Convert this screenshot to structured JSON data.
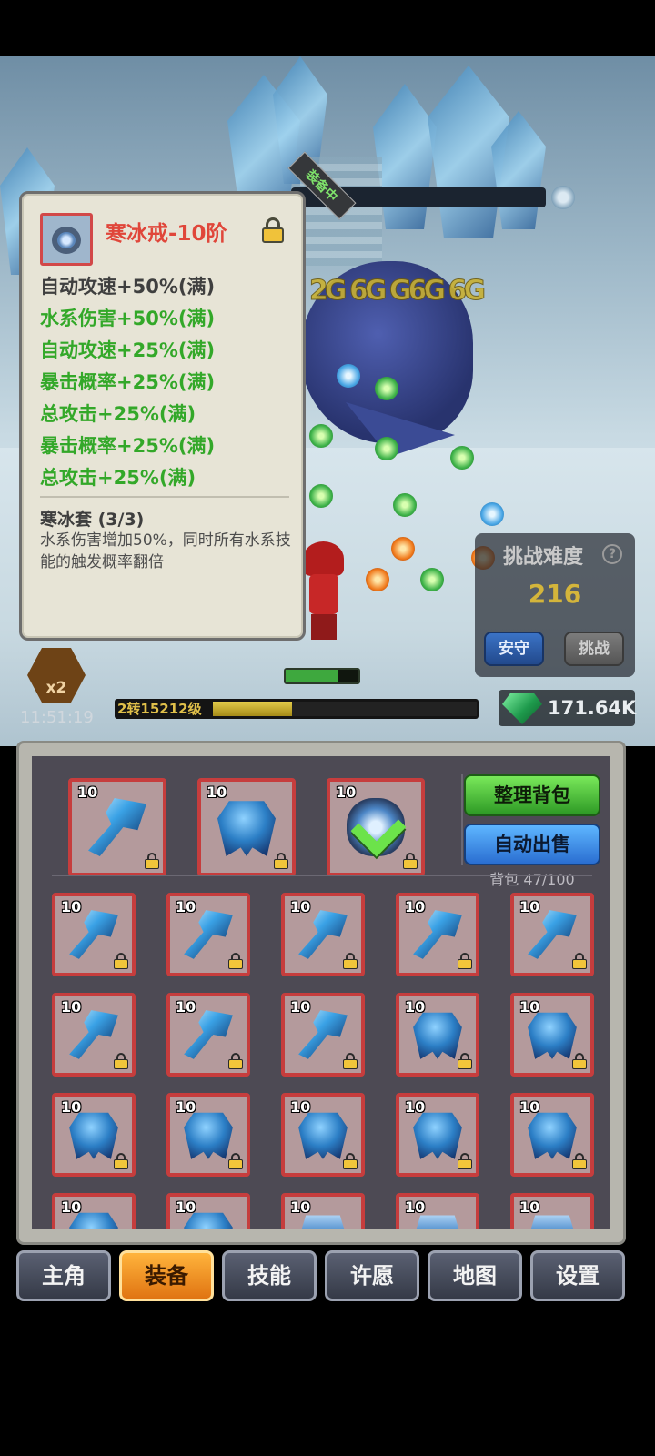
{
  "scene": {
    "challenge": {
      "title": "挑战难度",
      "help": "?",
      "value": "216",
      "safe_label": "安守",
      "challenge_label": "挑战"
    },
    "speed_label": "x2",
    "clock": "11:51:19",
    "level_label": "2转15212级",
    "level_progress": 0.3,
    "hero_hp": 0.72,
    "gems": "171.64K",
    "damage_text": "2G 6G G6G 6G",
    "colors": {
      "gem": "#1e9a4c",
      "level_bar": "#e2cb4a"
    }
  },
  "tooltip": {
    "badge": "装备中",
    "name": "寒冰戒-10阶",
    "icon": "ring-icon",
    "stats": [
      {
        "text": "自动攻速+50%(满)",
        "color": "#3f3f3f"
      },
      {
        "text": "水系伤害+50%(满)",
        "color": "#33a829"
      },
      {
        "text": "自动攻速+25%(满)",
        "color": "#33a829"
      },
      {
        "text": "暴击概率+25%(满)",
        "color": "#33a829"
      },
      {
        "text": "总攻击+25%(满)",
        "color": "#33a829"
      },
      {
        "text": "暴击概率+25%(满)",
        "color": "#33a829"
      },
      {
        "text": "总攻击+25%(满)",
        "color": "#33a829"
      }
    ],
    "set_name": "寒冰套 (3/3)",
    "set_desc": "水系伤害增加50%，同时所有水系技能的触发概率翻倍"
  },
  "bag": {
    "sort_label": "整理背包",
    "sell_label": "自动出售",
    "count": "背包 47/100",
    "equipped": [
      {
        "level": "10",
        "kind": "axe"
      },
      {
        "level": "10",
        "kind": "armor"
      },
      {
        "level": "10",
        "kind": "ring",
        "checked": true
      }
    ],
    "items": [
      {
        "level": "10",
        "kind": "axe"
      },
      {
        "level": "10",
        "kind": "axe"
      },
      {
        "level": "10",
        "kind": "axe"
      },
      {
        "level": "10",
        "kind": "axe"
      },
      {
        "level": "10",
        "kind": "axe"
      },
      {
        "level": "10",
        "kind": "axe"
      },
      {
        "level": "10",
        "kind": "axe"
      },
      {
        "level": "10",
        "kind": "axe"
      },
      {
        "level": "10",
        "kind": "armor"
      },
      {
        "level": "10",
        "kind": "armor"
      },
      {
        "level": "10",
        "kind": "armor"
      },
      {
        "level": "10",
        "kind": "armor"
      },
      {
        "level": "10",
        "kind": "armor"
      },
      {
        "level": "10",
        "kind": "armor"
      },
      {
        "level": "10",
        "kind": "armor"
      },
      {
        "level": "10",
        "kind": "armor"
      },
      {
        "level": "10",
        "kind": "armor"
      },
      {
        "level": "10",
        "kind": "ringbox"
      },
      {
        "level": "10",
        "kind": "ringbox"
      },
      {
        "level": "10",
        "kind": "ringbox"
      }
    ]
  },
  "nav": [
    {
      "label": "主角",
      "active": false
    },
    {
      "label": "装备",
      "active": true
    },
    {
      "label": "技能",
      "active": false
    },
    {
      "label": "许愿",
      "active": false
    },
    {
      "label": "地图",
      "active": false
    },
    {
      "label": "设置",
      "active": false
    }
  ]
}
